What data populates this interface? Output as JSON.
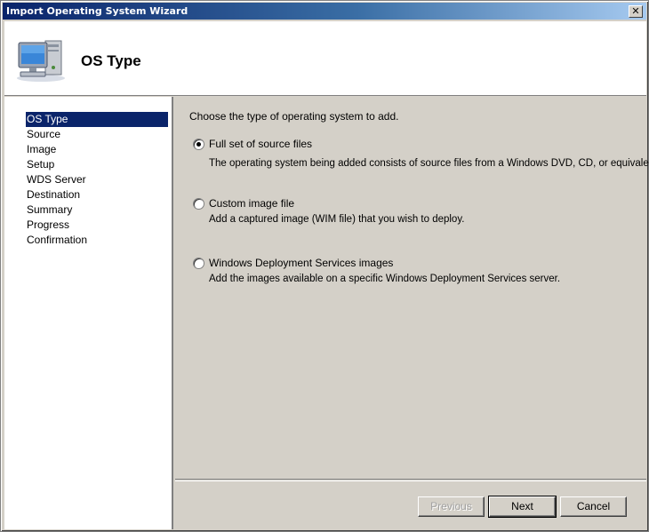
{
  "window": {
    "title": "Import Operating System Wizard",
    "close_glyph": "✕"
  },
  "header": {
    "title": "OS Type",
    "icon": "computer-icon"
  },
  "nav": {
    "items": [
      {
        "label": "OS Type",
        "active": true
      },
      {
        "label": "Source"
      },
      {
        "label": "Image"
      },
      {
        "label": "Setup"
      },
      {
        "label": "WDS Server"
      },
      {
        "label": "Destination"
      },
      {
        "label": "Summary"
      },
      {
        "label": "Progress"
      },
      {
        "label": "Confirmation"
      }
    ]
  },
  "main": {
    "instruction": "Choose the type of operating system to add.",
    "options": [
      {
        "label": "Full set of source files",
        "description": "The operating system being added consists of source files from a Windows DVD, CD, or equivalent.",
        "checked": true
      },
      {
        "label": "Custom image file",
        "description": "Add a captured image (WIM file) that you wish to deploy.",
        "checked": false
      },
      {
        "label": "Windows Deployment Services images",
        "description": "Add the images available on a specific Windows Deployment Services server.",
        "checked": false
      }
    ]
  },
  "buttons": {
    "previous": "Previous",
    "next": "Next",
    "cancel": "Cancel"
  },
  "colors": {
    "selection": "#0a246a",
    "titlebar_start": "#0a246a",
    "titlebar_end": "#a6caf0",
    "dialog_face": "#d4d0c8"
  }
}
